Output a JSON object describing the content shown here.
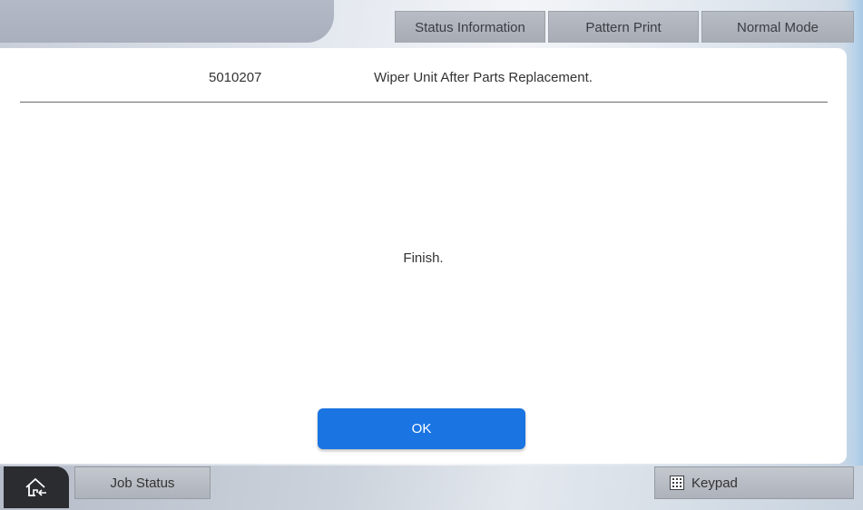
{
  "header": {
    "buttons": {
      "status_information": "Status Information",
      "pattern_print": "Pattern Print",
      "normal_mode": "Normal Mode"
    }
  },
  "dialog": {
    "code": "5010207",
    "title": "Wiper Unit After Parts Replacement.",
    "message": "Finish.",
    "ok_label": "OK"
  },
  "footer": {
    "home_icon": "home-icon",
    "job_status_label": "Job Status",
    "keypad_icon": "keypad-icon",
    "keypad_label": "Keypad"
  },
  "colors": {
    "accent": "#1a74e2",
    "home_button_bg": "#2a2c30"
  }
}
